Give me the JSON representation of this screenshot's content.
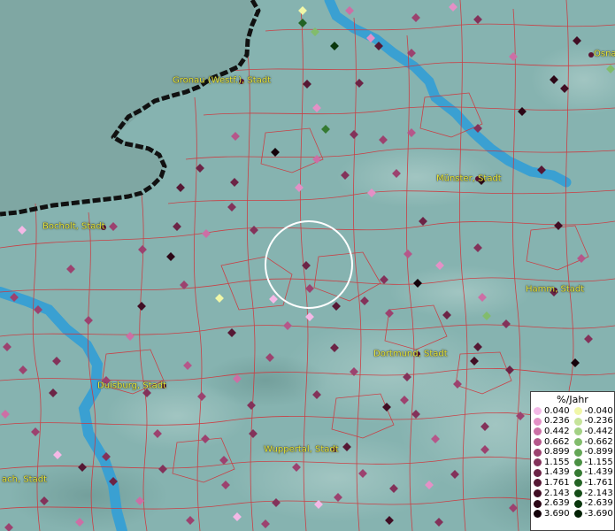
{
  "legend": {
    "title": "%/Jahr",
    "positive": [
      {
        "value": "0.040",
        "color": "#f4b8e6"
      },
      {
        "value": "0.236",
        "color": "#e490c6"
      },
      {
        "value": "0.442",
        "color": "#cc6fa5"
      },
      {
        "value": "0.662",
        "color": "#b5578a"
      },
      {
        "value": "0.899",
        "color": "#9c426f"
      },
      {
        "value": "1.155",
        "color": "#83325a"
      },
      {
        "value": "1.439",
        "color": "#6c2446"
      },
      {
        "value": "1.761",
        "color": "#561834"
      },
      {
        "value": "2.143",
        "color": "#410e24"
      },
      {
        "value": "2.639",
        "color": "#2c0716"
      },
      {
        "value": "3.690",
        "color": "#14020a"
      }
    ],
    "negative": [
      {
        "value": "-0.040",
        "color": "#f0f7a8"
      },
      {
        "value": "-0.236",
        "color": "#c6e49a"
      },
      {
        "value": "-0.442",
        "color": "#a3d184"
      },
      {
        "value": "-0.662",
        "color": "#82bc6c"
      },
      {
        "value": "-0.899",
        "color": "#64a656"
      },
      {
        "value": "-1.155",
        "color": "#4a9043"
      },
      {
        "value": "-1.439",
        "color": "#357a32"
      },
      {
        "value": "-1.761",
        "color": "#236324"
      },
      {
        "value": "-2.143",
        "color": "#154d18"
      },
      {
        "value": "-2.639",
        "color": "#0a370d"
      },
      {
        "value": "-3.690",
        "color": "#032205"
      }
    ]
  },
  "cities": [
    {
      "name": "Gronau (Westf.), Stadt"
    },
    {
      "name": "Bocholt, Stadt"
    },
    {
      "name": "Münster, Stadt"
    },
    {
      "name": "Hamm, Stadt"
    },
    {
      "name": "Dortmund, Stadt"
    },
    {
      "name": "Duisburg, Stadt"
    },
    {
      "name": "Wuppertal, Stadt"
    },
    {
      "name": "ach, Stadt"
    },
    {
      "name": "Osna"
    }
  ],
  "colors": {
    "land": "#86b3b0",
    "water": "#3aa0d2",
    "boundary": "#d0343a",
    "border": "#111111",
    "label": "#e8e83a"
  }
}
